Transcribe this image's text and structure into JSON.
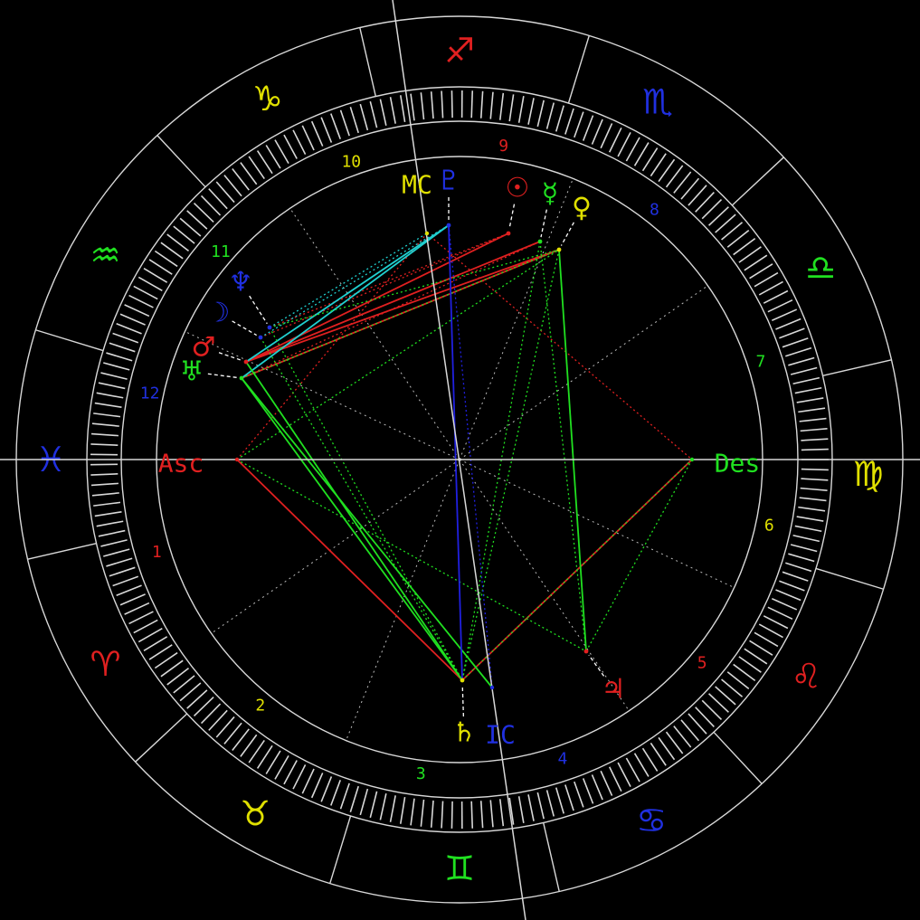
{
  "colors": {
    "background": "#000000",
    "ring": "#d8d8d8",
    "fire": "#e02020",
    "earth": "#e0e000",
    "air": "#20e020",
    "water": "#2020e0",
    "cyan": "#20d0d0"
  },
  "zodiac": [
    {
      "name": "pisces",
      "glyph": "♓",
      "color": "#2030e0"
    },
    {
      "name": "aries",
      "glyph": "♈",
      "color": "#e02020"
    },
    {
      "name": "taurus",
      "glyph": "♉",
      "color": "#e0e000"
    },
    {
      "name": "gemini",
      "glyph": "♊",
      "color": "#20e020"
    },
    {
      "name": "cancer",
      "glyph": "♋",
      "color": "#2030e0"
    },
    {
      "name": "leo",
      "glyph": "♌",
      "color": "#e02020"
    },
    {
      "name": "virgo",
      "glyph": "♍",
      "color": "#e0e000"
    },
    {
      "name": "libra",
      "glyph": "♎",
      "color": "#20e020"
    },
    {
      "name": "scorpio",
      "glyph": "♏",
      "color": "#2030e0"
    },
    {
      "name": "sagittarius",
      "glyph": "♐",
      "color": "#e02020"
    },
    {
      "name": "capricorn",
      "glyph": "♑",
      "color": "#e0e000"
    },
    {
      "name": "aquarius",
      "glyph": "♒",
      "color": "#20e020"
    }
  ],
  "houses": [
    {
      "label": "1",
      "color": "#e02020"
    },
    {
      "label": "2",
      "color": "#e0e000"
    },
    {
      "label": "3",
      "color": "#20e020"
    },
    {
      "label": "4",
      "color": "#2030e0"
    },
    {
      "label": "5",
      "color": "#e02020"
    },
    {
      "label": "6",
      "color": "#e0e000"
    },
    {
      "label": "7",
      "color": "#20e020"
    },
    {
      "label": "8",
      "color": "#2030e0"
    },
    {
      "label": "9",
      "color": "#e02020"
    },
    {
      "label": "10",
      "color": "#e0e000"
    },
    {
      "label": "11",
      "color": "#20e020"
    },
    {
      "label": "12",
      "color": "#2030e0"
    }
  ],
  "angles": [
    {
      "name": "asc",
      "label": "Asc",
      "color": "#e02020"
    },
    {
      "name": "des",
      "label": "Des",
      "color": "#20e020"
    },
    {
      "name": "mc",
      "label": "MC",
      "color": "#e0e000"
    },
    {
      "name": "ic",
      "label": "IC",
      "color": "#2030e0"
    }
  ],
  "planets": [
    {
      "name": "pluto",
      "glyph": "♇",
      "color": "#2030e0"
    },
    {
      "name": "sun",
      "glyph": "☉",
      "color": "#e02020"
    },
    {
      "name": "mercury",
      "glyph": "☿",
      "color": "#20e020"
    },
    {
      "name": "venus",
      "glyph": "♀",
      "color": "#e0e000"
    },
    {
      "name": "neptune",
      "glyph": "♆",
      "color": "#2030e0"
    },
    {
      "name": "moon",
      "glyph": "☽",
      "color": "#2030e0"
    },
    {
      "name": "mars",
      "glyph": "♂",
      "color": "#e02020"
    },
    {
      "name": "uranus",
      "glyph": "♅",
      "color": "#20e020"
    },
    {
      "name": "saturn",
      "glyph": "♄",
      "color": "#e0e000"
    },
    {
      "name": "jupiter",
      "glyph": "♃",
      "color": "#e02020"
    }
  ]
}
